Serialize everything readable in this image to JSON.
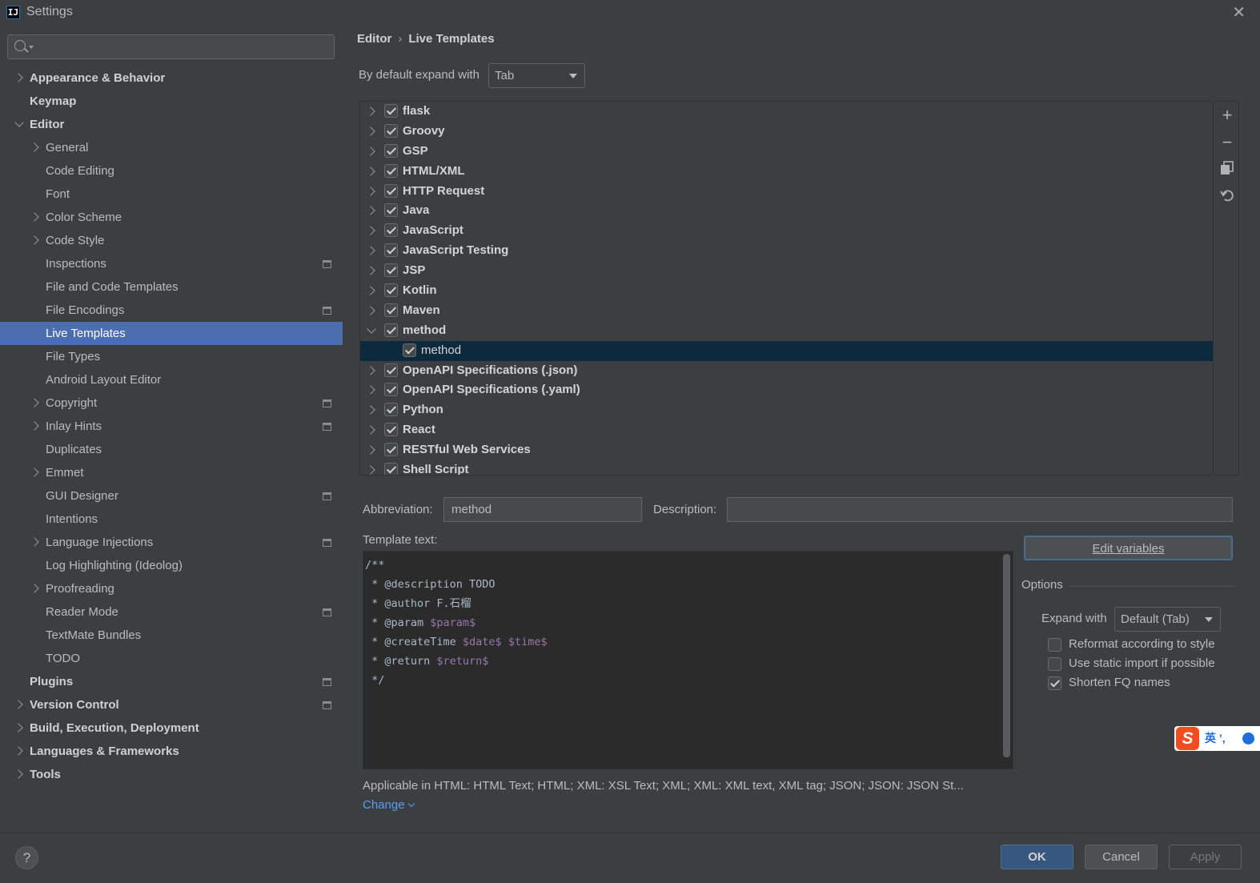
{
  "window": {
    "title": "Settings",
    "app_icon": "IJ",
    "close_icon": "close-icon"
  },
  "sidebar": {
    "search": {
      "placeholder": "",
      "value": ""
    },
    "items": [
      {
        "label": "Appearance & Behavior",
        "bold": true,
        "level": 0,
        "chevron": "right",
        "badge": false,
        "selected": false
      },
      {
        "label": "Keymap",
        "bold": true,
        "level": 0,
        "chevron": "none",
        "badge": false,
        "selected": false
      },
      {
        "label": "Editor",
        "bold": true,
        "level": 0,
        "chevron": "down",
        "badge": false,
        "selected": false
      },
      {
        "label": "General",
        "bold": false,
        "level": 1,
        "chevron": "right",
        "badge": false,
        "selected": false
      },
      {
        "label": "Code Editing",
        "bold": false,
        "level": 1,
        "chevron": "none",
        "badge": false,
        "selected": false
      },
      {
        "label": "Font",
        "bold": false,
        "level": 1,
        "chevron": "none",
        "badge": false,
        "selected": false
      },
      {
        "label": "Color Scheme",
        "bold": false,
        "level": 1,
        "chevron": "right",
        "badge": false,
        "selected": false
      },
      {
        "label": "Code Style",
        "bold": false,
        "level": 1,
        "chevron": "right",
        "badge": false,
        "selected": false
      },
      {
        "label": "Inspections",
        "bold": false,
        "level": 1,
        "chevron": "none",
        "badge": true,
        "selected": false
      },
      {
        "label": "File and Code Templates",
        "bold": false,
        "level": 1,
        "chevron": "none",
        "badge": false,
        "selected": false
      },
      {
        "label": "File Encodings",
        "bold": false,
        "level": 1,
        "chevron": "none",
        "badge": true,
        "selected": false
      },
      {
        "label": "Live Templates",
        "bold": false,
        "level": 1,
        "chevron": "none",
        "badge": false,
        "selected": true
      },
      {
        "label": "File Types",
        "bold": false,
        "level": 1,
        "chevron": "none",
        "badge": false,
        "selected": false
      },
      {
        "label": "Android Layout Editor",
        "bold": false,
        "level": 1,
        "chevron": "none",
        "badge": false,
        "selected": false
      },
      {
        "label": "Copyright",
        "bold": false,
        "level": 1,
        "chevron": "right",
        "badge": true,
        "selected": false
      },
      {
        "label": "Inlay Hints",
        "bold": false,
        "level": 1,
        "chevron": "right",
        "badge": true,
        "selected": false
      },
      {
        "label": "Duplicates",
        "bold": false,
        "level": 1,
        "chevron": "none",
        "badge": false,
        "selected": false
      },
      {
        "label": "Emmet",
        "bold": false,
        "level": 1,
        "chevron": "right",
        "badge": false,
        "selected": false
      },
      {
        "label": "GUI Designer",
        "bold": false,
        "level": 1,
        "chevron": "none",
        "badge": true,
        "selected": false
      },
      {
        "label": "Intentions",
        "bold": false,
        "level": 1,
        "chevron": "none",
        "badge": false,
        "selected": false
      },
      {
        "label": "Language Injections",
        "bold": false,
        "level": 1,
        "chevron": "right",
        "badge": true,
        "selected": false
      },
      {
        "label": "Log Highlighting (Ideolog)",
        "bold": false,
        "level": 1,
        "chevron": "none",
        "badge": false,
        "selected": false
      },
      {
        "label": "Proofreading",
        "bold": false,
        "level": 1,
        "chevron": "right",
        "badge": false,
        "selected": false
      },
      {
        "label": "Reader Mode",
        "bold": false,
        "level": 1,
        "chevron": "none",
        "badge": true,
        "selected": false
      },
      {
        "label": "TextMate Bundles",
        "bold": false,
        "level": 1,
        "chevron": "none",
        "badge": false,
        "selected": false
      },
      {
        "label": "TODO",
        "bold": false,
        "level": 1,
        "chevron": "none",
        "badge": false,
        "selected": false
      },
      {
        "label": "Plugins",
        "bold": true,
        "level": 0,
        "chevron": "none",
        "badge": true,
        "selected": false
      },
      {
        "label": "Version Control",
        "bold": true,
        "level": 0,
        "chevron": "right",
        "badge": true,
        "selected": false
      },
      {
        "label": "Build, Execution, Deployment",
        "bold": true,
        "level": 0,
        "chevron": "right",
        "badge": false,
        "selected": false
      },
      {
        "label": "Languages & Frameworks",
        "bold": true,
        "level": 0,
        "chevron": "right",
        "badge": false,
        "selected": false
      },
      {
        "label": "Tools",
        "bold": true,
        "level": 0,
        "chevron": "right",
        "badge": false,
        "selected": false
      }
    ]
  },
  "breadcrumb": {
    "parent": "Editor",
    "separator": "›",
    "current": "Live Templates"
  },
  "expand_default": {
    "label": "By default expand with",
    "value": "Tab"
  },
  "templates": [
    {
      "label": "flask",
      "checked": true,
      "chevron": "right",
      "child": false,
      "selected": false
    },
    {
      "label": "Groovy",
      "checked": true,
      "chevron": "right",
      "child": false,
      "selected": false
    },
    {
      "label": "GSP",
      "checked": true,
      "chevron": "right",
      "child": false,
      "selected": false
    },
    {
      "label": "HTML/XML",
      "checked": true,
      "chevron": "right",
      "child": false,
      "selected": false
    },
    {
      "label": "HTTP Request",
      "checked": true,
      "chevron": "right",
      "child": false,
      "selected": false
    },
    {
      "label": "Java",
      "checked": true,
      "chevron": "right",
      "child": false,
      "selected": false
    },
    {
      "label": "JavaScript",
      "checked": true,
      "chevron": "right",
      "child": false,
      "selected": false
    },
    {
      "label": "JavaScript Testing",
      "checked": true,
      "chevron": "right",
      "child": false,
      "selected": false
    },
    {
      "label": "JSP",
      "checked": true,
      "chevron": "right",
      "child": false,
      "selected": false
    },
    {
      "label": "Kotlin",
      "checked": true,
      "chevron": "right",
      "child": false,
      "selected": false
    },
    {
      "label": "Maven",
      "checked": true,
      "chevron": "right",
      "child": false,
      "selected": false
    },
    {
      "label": "method",
      "checked": true,
      "chevron": "down",
      "child": false,
      "selected": false
    },
    {
      "label": "method",
      "checked": true,
      "chevron": "none",
      "child": true,
      "selected": true
    },
    {
      "label": "OpenAPI Specifications (.json)",
      "checked": true,
      "chevron": "right",
      "child": false,
      "selected": false
    },
    {
      "label": "OpenAPI Specifications (.yaml)",
      "checked": true,
      "chevron": "right",
      "child": false,
      "selected": false
    },
    {
      "label": "Python",
      "checked": true,
      "chevron": "right",
      "child": false,
      "selected": false
    },
    {
      "label": "React",
      "checked": true,
      "chevron": "right",
      "child": false,
      "selected": false
    },
    {
      "label": "RESTful Web Services",
      "checked": true,
      "chevron": "right",
      "child": false,
      "selected": false
    },
    {
      "label": "Shell Script",
      "checked": true,
      "chevron": "right",
      "child": false,
      "selected": false
    }
  ],
  "side_tools": {
    "add": "+",
    "remove": "−",
    "copy_icon": "copy-icon",
    "restore_icon": "undo-icon"
  },
  "abbreviation": {
    "label": "Abbreviation:",
    "value": "method"
  },
  "description": {
    "label": "Description:",
    "value": ""
  },
  "template_text": {
    "label": "Template text:",
    "lines": [
      [
        {
          "t": "/**",
          "v": false
        }
      ],
      [
        {
          "t": " * @description TODO",
          "v": false
        }
      ],
      [
        {
          "t": " * @author F.石榴",
          "v": false
        }
      ],
      [
        {
          "t": " * @param ",
          "v": false
        },
        {
          "t": "$param$",
          "v": true
        }
      ],
      [
        {
          "t": " * @createTime ",
          "v": false
        },
        {
          "t": "$date$",
          "v": true
        },
        {
          "t": " ",
          "v": false
        },
        {
          "t": "$time$",
          "v": true
        }
      ],
      [
        {
          "t": " * @return ",
          "v": false
        },
        {
          "t": "$return$",
          "v": true
        }
      ],
      [
        {
          "t": " */",
          "v": false
        }
      ]
    ]
  },
  "edit_variables": {
    "label": "Edit variables"
  },
  "options": {
    "title": "Options",
    "expand_with": {
      "label": "Expand with",
      "value": "Default (Tab)"
    },
    "checks": [
      {
        "label": "Reformat according to style",
        "checked": false
      },
      {
        "label": "Use static import if possible",
        "checked": false
      },
      {
        "label": "Shorten FQ names",
        "checked": true
      }
    ]
  },
  "applicable": "Applicable in HTML: HTML Text; HTML; XML: XSL Text; XML; XML: XML text, XML tag; JSON; JSON: JSON St...",
  "change_link": "Change",
  "footer": {
    "help": "?",
    "ok": "OK",
    "cancel": "Cancel",
    "apply": "Apply"
  },
  "ime": {
    "logo": "S",
    "text": "英 ’,"
  },
  "colors": {
    "selection": "#4b6eaf",
    "list_selection": "#0d293e",
    "link": "#589df6",
    "template_var": "#9876aa",
    "ok_button": "#365880"
  }
}
